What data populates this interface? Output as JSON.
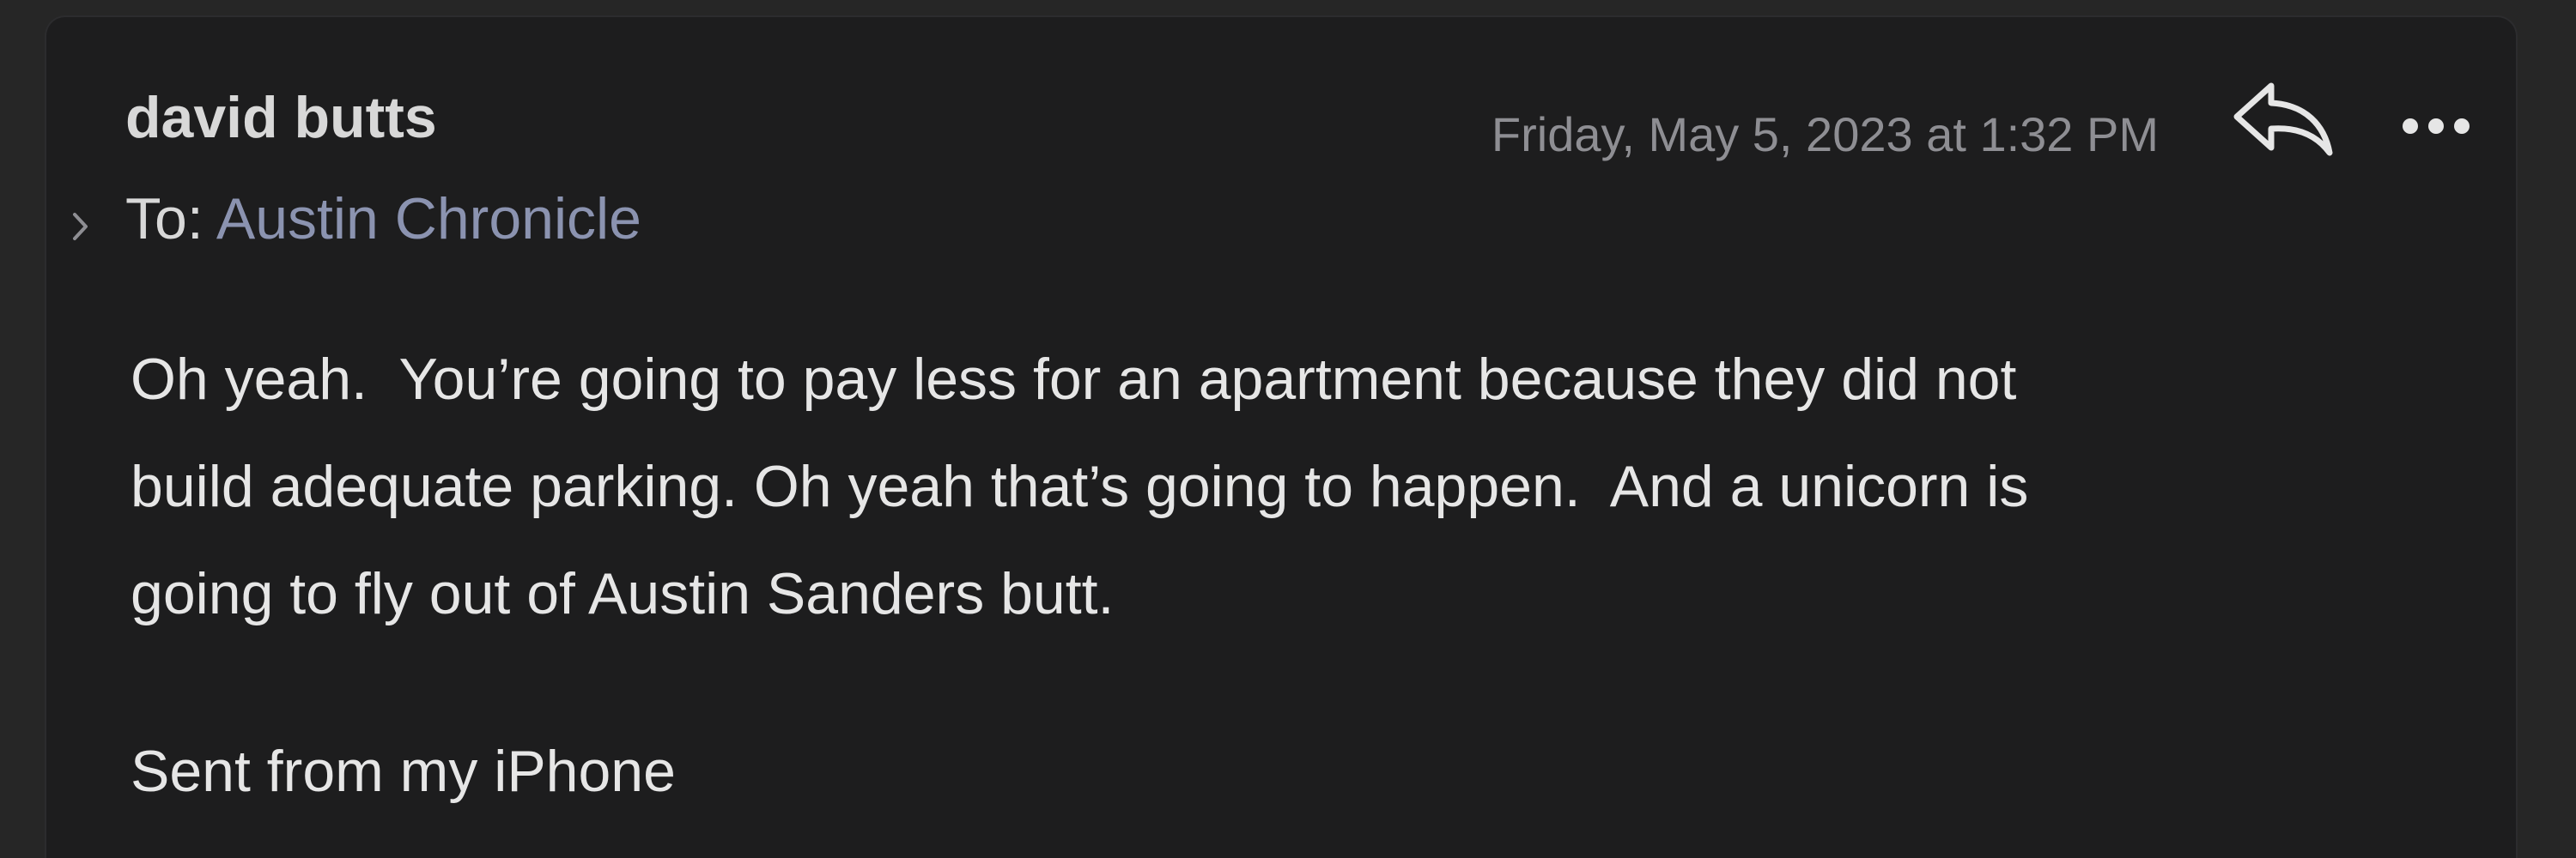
{
  "message": {
    "sender": "david butts",
    "date": "Friday, May 5, 2023 at 1:32 PM",
    "to_label": "To:",
    "to_recipient": "Austin Chronicle",
    "body_lines": [
      "Oh yeah.  You’re going to pay less for an apartment because they did not",
      "build adequate parking. Oh yeah that’s going to happen.  And a unicorn is",
      "going to fly out of Austin Sanders butt."
    ],
    "signature": "Sent from my iPhone"
  },
  "toolbar": {
    "reply_icon": "reply-arrow",
    "more_icon": "ellipsis"
  },
  "colors": {
    "background": "#262626",
    "card": "#1d1d1e",
    "text_primary": "#e6e6e6",
    "text_secondary": "#8e8e93",
    "recipient_link": "#8b93b0"
  }
}
